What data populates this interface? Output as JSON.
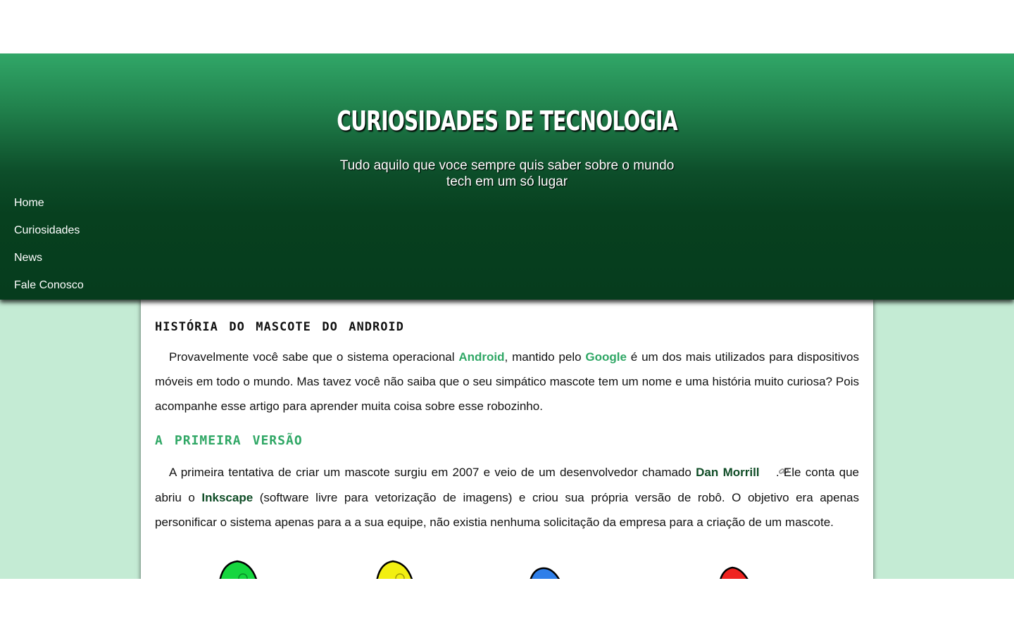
{
  "header": {
    "title": "CURIOSIDADES DE TECNOLOGIA",
    "subtitle": "Tudo aquilo que voce sempre quis saber sobre o mundo tech em um só lugar"
  },
  "nav": {
    "items": [
      {
        "label": "Home"
      },
      {
        "label": "Curiosidades"
      },
      {
        "label": "News"
      },
      {
        "label": "Fale Conosco"
      }
    ]
  },
  "article": {
    "title": "História do mascote do Android",
    "p1": {
      "t1": "Provavelmente você sabe que o sistema operacional ",
      "link1": "Android",
      "t2": ", mantido pelo ",
      "link2": "Google",
      "t3": " é um dos mais utilizados para dispositivos móveis em todo o mundo. Mas tavez você não saiba que o seu simpático mascote tem um nome e uma história muito curiosa? Pois acompanhe esse artigo para aprender muita coisa sobre esse robozinho."
    },
    "section1_title": "A primeira versão",
    "p2": {
      "t1": "A primeira tentativa de criar um mascote surgiu em 2007 e veio de um desenvolvedor chamado ",
      "link1": "Dan Morrill",
      "link_icon": "link-icon",
      "t2": ". Ele conta que abriu o ",
      "link2": "Inkscape",
      "t3": " (software livre para vetorização de imagens) e criou sua própria versão de robô. O objetivo era apenas personificar o sistema apenas para a a sua equipe, não existia nenhuma solicitação da empresa para a criação de um mascote."
    },
    "mascot_colors": [
      "#16d63f",
      "#f2ef12",
      "#2f7fe9",
      "#ef2420"
    ]
  },
  "colors": {
    "accent": "#2fa765",
    "accent_dark": "#0f4c26",
    "page_bg": "#c4ebd4"
  }
}
